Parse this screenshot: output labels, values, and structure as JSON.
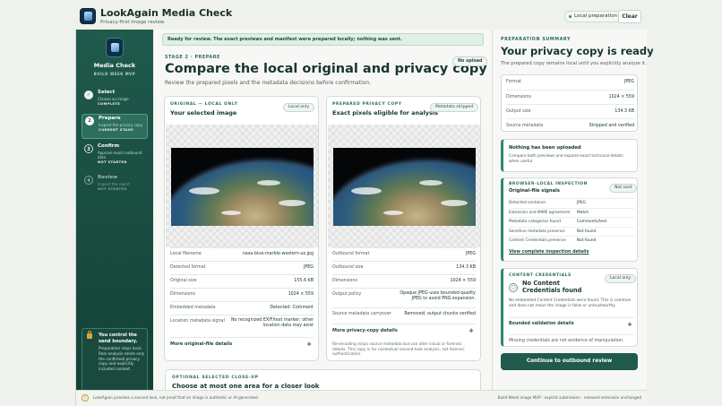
{
  "app": {
    "title": "LookAgain Media Check",
    "subtitle": "Privacy-first image review",
    "local_pill": "Local preparation",
    "clear_label": "Clear"
  },
  "sidebar": {
    "title": "Media Check",
    "subtitle": "BUILD WEEK MVP",
    "steps": [
      {
        "num": "✓",
        "label": "Select",
        "desc": "Choose an image",
        "state": "COMPLETE"
      },
      {
        "num": "2",
        "label": "Prepare",
        "desc": "Inspect the privacy copy",
        "state": "CURRENT STAGE"
      },
      {
        "num": "3",
        "label": "Confirm",
        "desc": "Approve exact outbound data",
        "state": "NOT STARTED"
      },
      {
        "num": "4",
        "label": "Review",
        "desc": "Inspect the report",
        "state": "NOT STARTED"
      }
    ],
    "note_title": "You control the send boundary.",
    "note_body": "Preparation stays local. Real analysis sends only the confirmed privacy copy and explicitly included context."
  },
  "main": {
    "banner": "Ready for review. The exact previews and manifest were prepared locally; nothing was sent.",
    "stage_kicker": "STAGE 2 · PREPARE",
    "heading": "Compare the local original and privacy copy",
    "description": "Review the prepared pixels and the metadata decisions before confirmation.",
    "no_upload": "No upload",
    "original": {
      "kicker": "ORIGINAL — LOCAL ONLY",
      "title": "Your selected image",
      "tag": "Local only",
      "rows": [
        {
          "k": "Local filename",
          "v": "nasa-blue-marble-western-us.jpg"
        },
        {
          "k": "Detected format",
          "v": "JPEG"
        },
        {
          "k": "Original size",
          "v": "155.6 KB"
        },
        {
          "k": "Dimensions",
          "v": "1024 × 559"
        },
        {
          "k": "Embedded metadata",
          "v": "Detected: Comment"
        },
        {
          "k": "Location metadata signal",
          "v": "No recognized EXIF/text marker; other location data may exist"
        }
      ],
      "details": "More original-file details"
    },
    "prepared": {
      "kicker": "PREPARED PRIVACY COPY",
      "title": "Exact pixels eligible for analysis",
      "tag": "Metadata stripped",
      "rows": [
        {
          "k": "Outbound format",
          "v": "JPEG"
        },
        {
          "k": "Outbound size",
          "v": "134.3 KB"
        },
        {
          "k": "Dimensions",
          "v": "1024 × 559"
        },
        {
          "k": "Output policy",
          "v": "Opaque JPEG uses bounded-quality JPEG to avoid PNG expansion."
        },
        {
          "k": "Source metadata carryover",
          "v": "Removed; output chunks verified"
        }
      ],
      "details": "More privacy-copy details",
      "note": "Re-encoding strips source metadata but can alter visual or forensic details. This copy is for contextual second-look analysis, not forensic authentication."
    },
    "closeup": {
      "kicker": "OPTIONAL SELECTED CLOSE-UP",
      "title": "Choose at most one area for a closer look"
    }
  },
  "summary": {
    "kicker": "PREPARATION SUMMARY",
    "heading": "Your privacy copy is ready",
    "description": "The prepared copy remains local until you explicitly analyze it.",
    "rows": [
      {
        "k": "Format",
        "v": "JPEG"
      },
      {
        "k": "Dimensions",
        "v": "1024 × 559"
      },
      {
        "k": "Output size",
        "v": "134.3 KB"
      },
      {
        "k": "Source metadata",
        "v": "Stripped and verified"
      }
    ],
    "uploaded_title": "Nothing has been uploaded",
    "uploaded_body": "Compare both previews and expand exact technical details when useful.",
    "inspection": {
      "kicker": "BROWSER-LOCAL INSPECTION",
      "title": "Original-file signals",
      "tag": "Not sent",
      "rows": [
        {
          "k": "Detected container",
          "v": "JPEG"
        },
        {
          "k": "Extension and MIME agreement",
          "v": "Match"
        },
        {
          "k": "Metadata categories found",
          "v": "Comments/text"
        },
        {
          "k": "Sensitive metadata presence",
          "v": "Not found"
        },
        {
          "k": "Content Credentials presence",
          "v": "Not found"
        }
      ],
      "link": "View complete inspection details"
    },
    "credentials": {
      "kicker": "CONTENT CREDENTIALS",
      "tag": "Local only",
      "title": "No Content Credentials found",
      "body": "No embedded Content Credentials were found. This is common and does not mean the image is false or untrustworthy.",
      "bounded": "Bounded validation details",
      "missing": "Missing credentials are not evidence of manipulation."
    },
    "cta": "Continue to outbound review"
  },
  "footer": {
    "left": "LookAgain provides a second look, not proof that an image is authentic or AI-generated.",
    "right": "Build Week image MVP · explicit submission · released extension unchanged"
  }
}
